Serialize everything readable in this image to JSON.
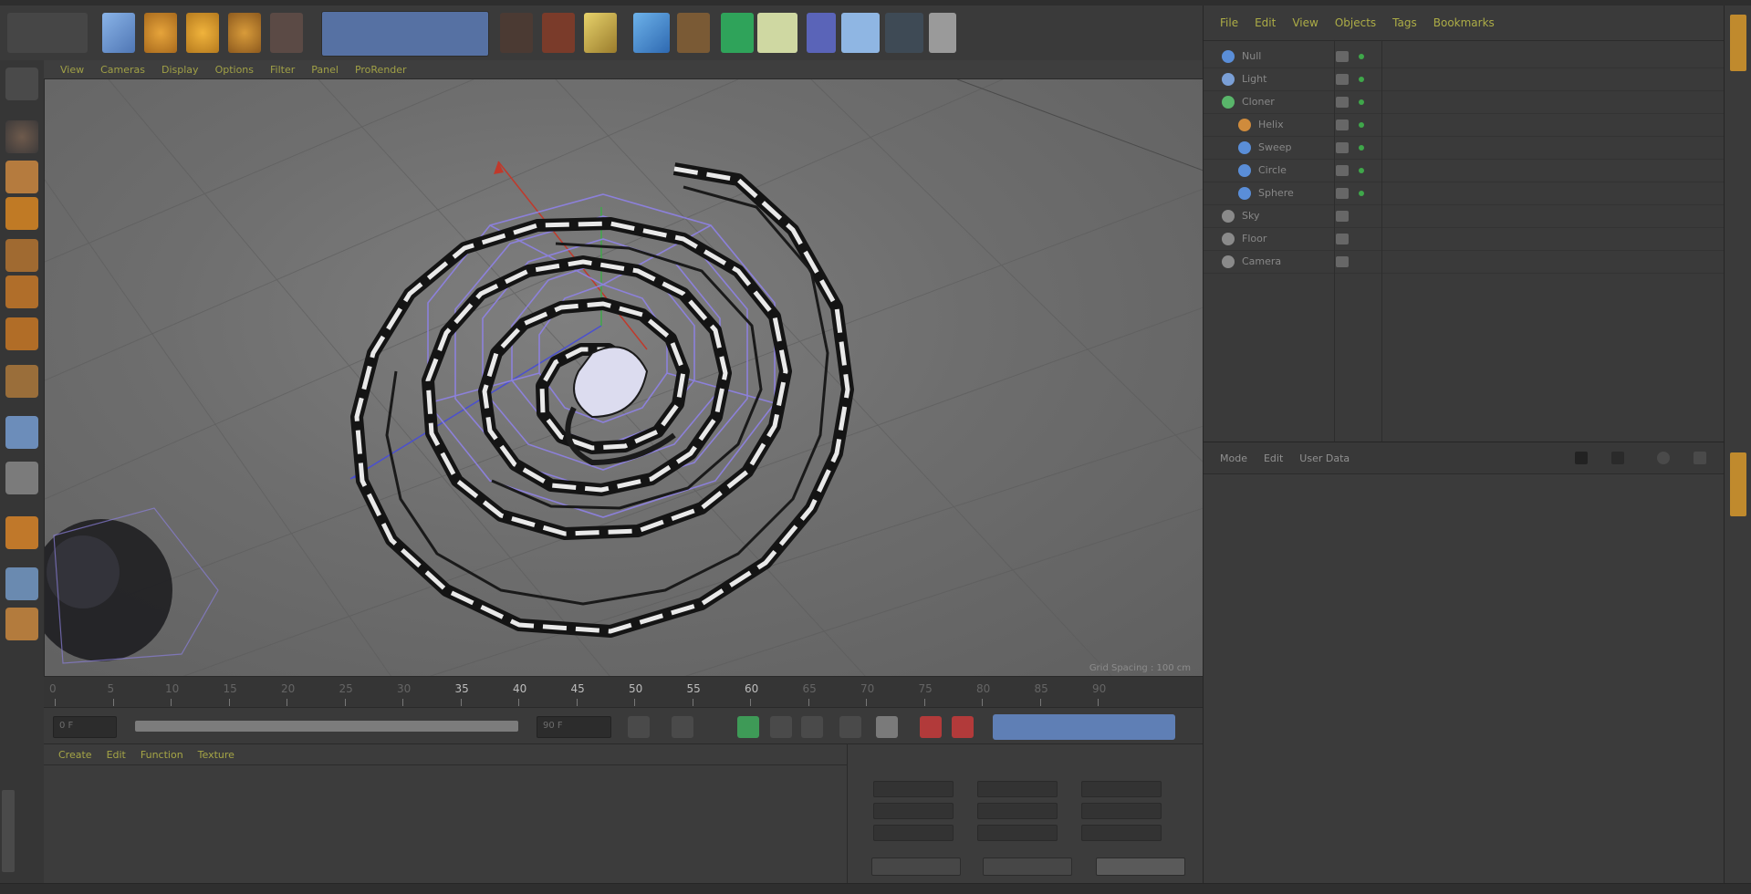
{
  "app": {
    "name": "3D application workspace"
  },
  "viewport": {
    "menu": [
      "View",
      "Cameras",
      "Display",
      "Options",
      "Filter",
      "Panel",
      "ProRender"
    ],
    "status": "Grid Spacing : 100 cm"
  },
  "timeline": {
    "ticks": [
      "0",
      "5",
      "10",
      "15",
      "20",
      "25",
      "30",
      "35",
      "40",
      "45",
      "50",
      "55",
      "60",
      "65",
      "70",
      "75",
      "80",
      "85",
      "90"
    ],
    "start_frame": "0 F",
    "end_frame": "90 F"
  },
  "material_manager": {
    "menu": [
      "Create",
      "Edit",
      "Function",
      "Texture"
    ]
  },
  "object_manager": {
    "menu": [
      "File",
      "Edit",
      "View",
      "Objects",
      "Tags",
      "Bookmarks"
    ],
    "objects": [
      {
        "name": "Null",
        "icon_color": "#5a8ed8",
        "indent": 0
      },
      {
        "name": "Light",
        "icon_color": "#7a9fd6",
        "indent": 0
      },
      {
        "name": "Cloner",
        "icon_color": "#59b56a",
        "indent": 0
      },
      {
        "name": "Helix",
        "icon_color": "#cf8b3c",
        "indent": 1
      },
      {
        "name": "Sweep",
        "icon_color": "#5a8ed8",
        "indent": 1
      },
      {
        "name": "Circle",
        "icon_color": "#5a8ed8",
        "indent": 1
      },
      {
        "name": "Sphere",
        "icon_color": "#5a8ed8",
        "indent": 1
      },
      {
        "name": "Sky",
        "icon_color": "#8a8a8a",
        "indent": 0
      },
      {
        "name": "Floor",
        "icon_color": "#8a8a8a",
        "indent": 0
      },
      {
        "name": "Camera",
        "icon_color": "#8a8a8a",
        "indent": 0
      }
    ]
  },
  "attribute_manager": {
    "tabs": [
      "Mode",
      "Edit",
      "User Data"
    ]
  },
  "colors": {
    "accent_yellow": "#c9c94a",
    "axis_x": "#c0392b",
    "axis_y": "#3fa74a",
    "axis_z": "#4a4fd0",
    "wire_purple": "#8f82e6"
  }
}
